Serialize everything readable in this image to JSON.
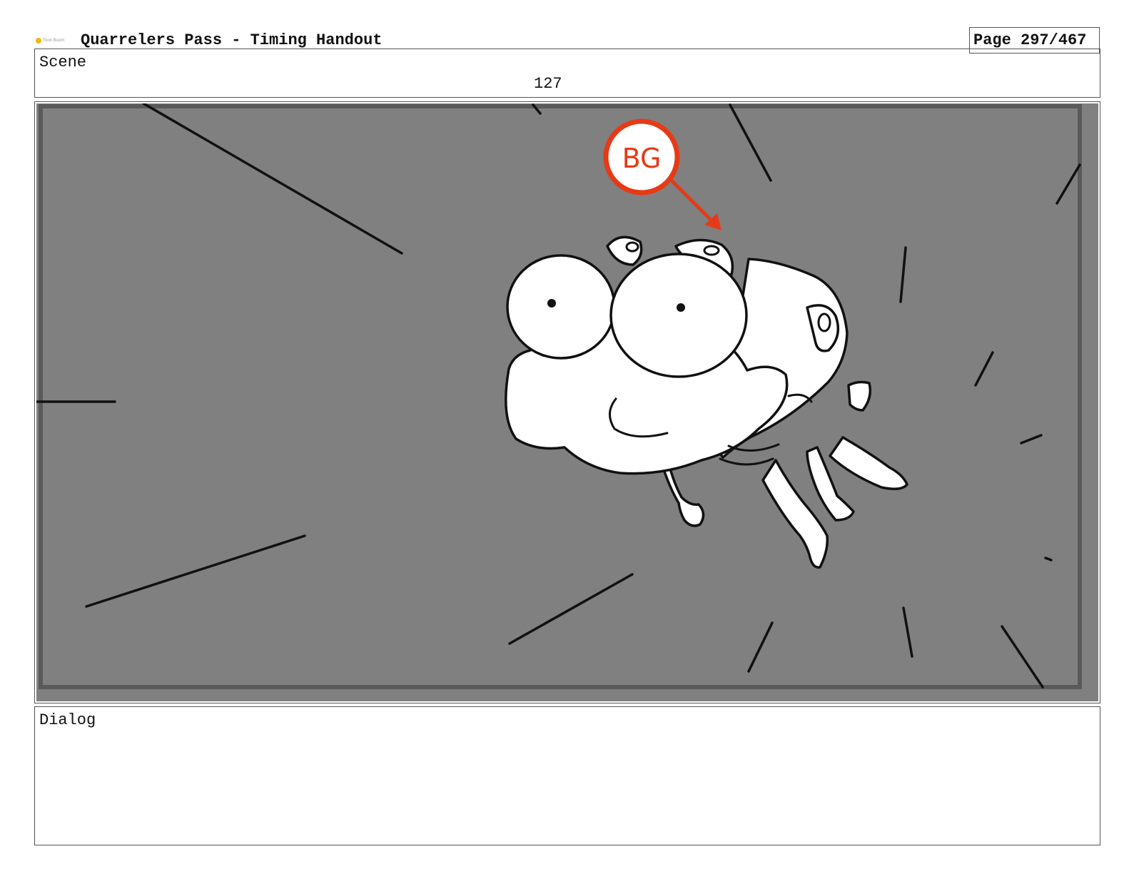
{
  "header": {
    "logo_text": "Toon Boom",
    "title": "Quarrelers Pass - Timing Handout",
    "page": "Page 297/467"
  },
  "scene": {
    "label": "Scene",
    "number": "127"
  },
  "panel": {
    "annotation_text": "BG",
    "colors": {
      "background": "#808080",
      "frame": "#5a5a5a",
      "ink": "#111111",
      "annotation": "#e63a17"
    }
  },
  "dialog": {
    "label": "Dialog"
  }
}
